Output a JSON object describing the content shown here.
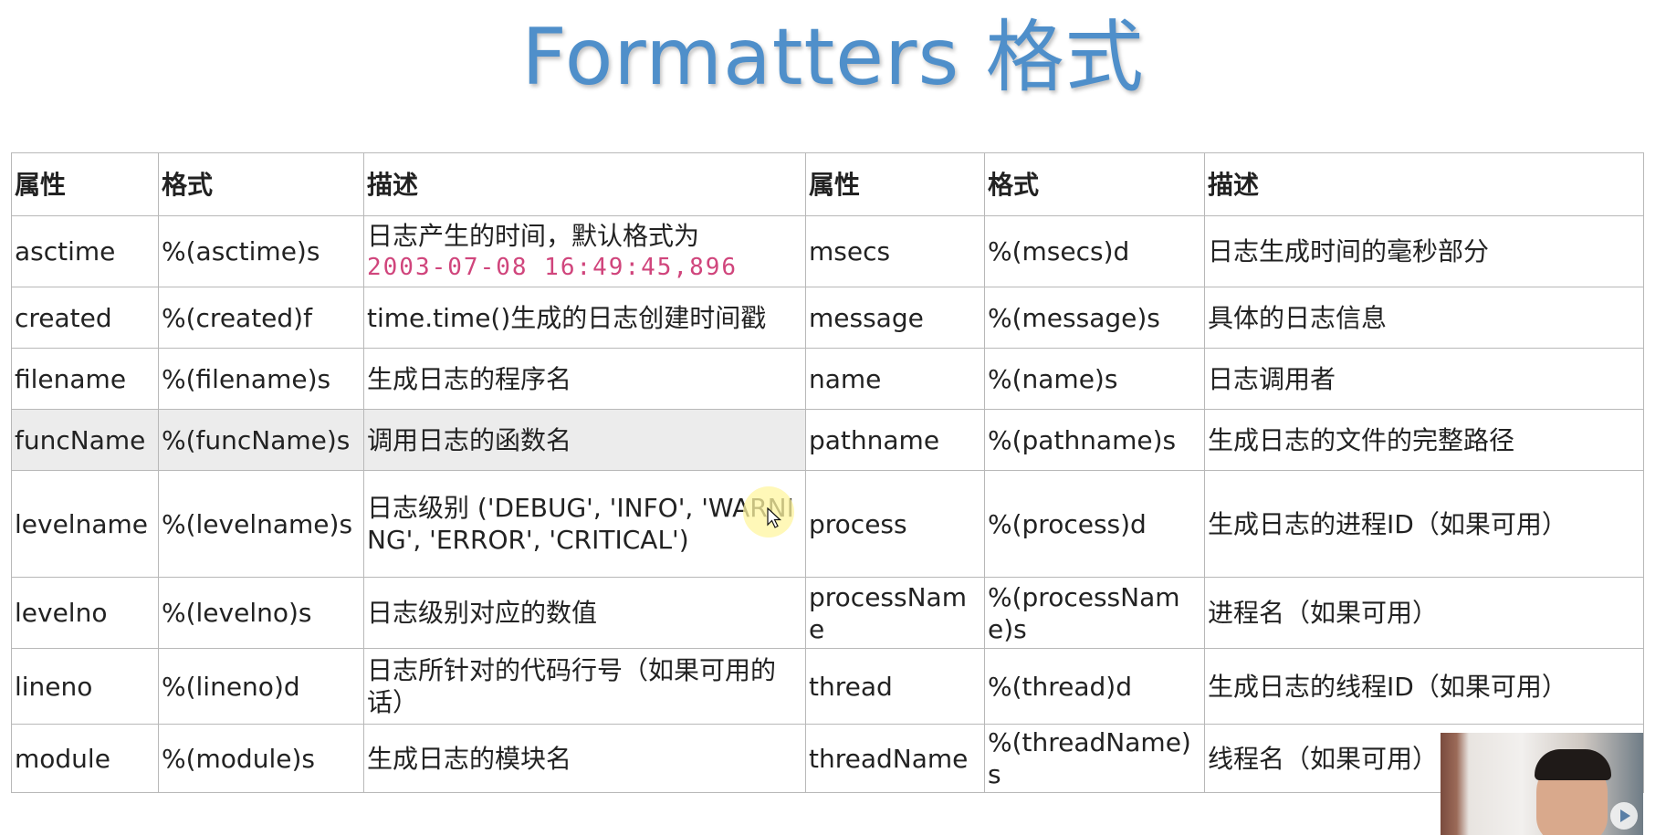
{
  "title": "Formatters 格式",
  "table": {
    "headers": [
      "属性",
      "格式",
      "描述",
      "属性",
      "格式",
      "描述"
    ],
    "rows": [
      {
        "attr1": "asctime",
        "fmt1": "%(asctime)s",
        "desc1_text": "日志产生的时间，默认格式为",
        "desc1_code": "2003-07-08 16:49:45,896",
        "attr2": "msecs",
        "fmt2": "%(msecs)d",
        "desc2": "日志生成时间的毫秒部分"
      },
      {
        "attr1": "created",
        "fmt1": "%(created)f",
        "desc1": "time.time()生成的日志创建时间戳",
        "attr2": "message",
        "fmt2": "%(message)s",
        "desc2": "具体的日志信息"
      },
      {
        "attr1": "filename",
        "fmt1": "%(filename)s",
        "desc1": "生成日志的程序名",
        "attr2": "name",
        "fmt2": "%(name)s",
        "desc2": "日志调用者"
      },
      {
        "attr1": "funcName",
        "fmt1": "%(funcName)s",
        "desc1": "调用日志的函数名",
        "attr2": "pathname",
        "fmt2": "%(pathname)s",
        "desc2": "生成日志的文件的完整路径"
      },
      {
        "attr1": "levelname",
        "fmt1": "%(levelname)s",
        "desc1": "日志级别 ('DEBUG', 'INFO', 'WARNING', 'ERROR', 'CRITICAL')",
        "attr2": "process",
        "fmt2": "%(process)d",
        "desc2": "生成日志的进程ID（如果可用）"
      },
      {
        "attr1": "levelno",
        "fmt1": "%(levelno)s",
        "desc1": "日志级别对应的数值",
        "attr2": "processName",
        "fmt2": "%(processName)s",
        "desc2": "进程名（如果可用）"
      },
      {
        "attr1": "lineno",
        "fmt1": "%(lineno)d",
        "desc1": "日志所针对的代码行号（如果可用的话）",
        "attr2": "thread",
        "fmt2": "%(thread)d",
        "desc2": "生成日志的线程ID（如果可用）"
      },
      {
        "attr1": "module",
        "fmt1": "%(module)s",
        "desc1": "生成日志的模块名",
        "attr2": "threadName",
        "fmt2": "%(threadName)s",
        "desc2": "线程名（如果可用）"
      }
    ]
  },
  "colors": {
    "title": "#4f8fca",
    "code": "#d0457c",
    "highlight_row": "#ececec",
    "border": "#b8b8b8"
  },
  "icons": {
    "cursor": "mouse-pointer-icon",
    "video_play": "play-icon"
  }
}
